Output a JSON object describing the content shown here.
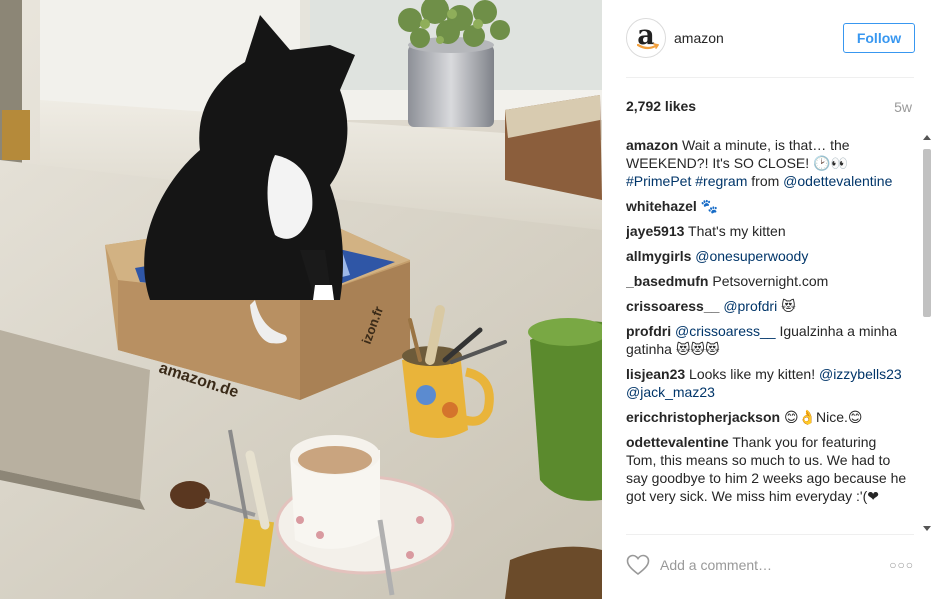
{
  "post": {
    "username": "amazon",
    "follow_label": "Follow",
    "likes": "2,792 likes",
    "age": "5w",
    "avatar_letter": "a",
    "add_comment_placeholder": "Add a comment…",
    "more_label": "○○○"
  },
  "photo_text": {
    "box_brand_1": "izon.fr",
    "box_brand_2": "amazon.de"
  },
  "comments": [
    {
      "user": "amazon",
      "parts": [
        {
          "t": "text",
          "v": " Wait a minute, is that… the WEEKEND?! It's SO CLOSE! 🕑👀 "
        },
        {
          "t": "link",
          "v": "#PrimePet"
        },
        {
          "t": "text",
          "v": " "
        },
        {
          "t": "link",
          "v": "#regram"
        },
        {
          "t": "text",
          "v": " from "
        },
        {
          "t": "link",
          "v": "@odettevalentine"
        }
      ]
    },
    {
      "user": "whitehazel",
      "parts": [
        {
          "t": "text",
          "v": " 🐾"
        }
      ]
    },
    {
      "user": "jaye5913",
      "parts": [
        {
          "t": "text",
          "v": " That's my kitten"
        }
      ]
    },
    {
      "user": "allmygirls",
      "parts": [
        {
          "t": "text",
          "v": " "
        },
        {
          "t": "link",
          "v": "@onesuperwoody"
        }
      ]
    },
    {
      "user": "_basedmufn",
      "parts": [
        {
          "t": "text",
          "v": " Petsovernight.com"
        }
      ]
    },
    {
      "user": "crissoaress__",
      "parts": [
        {
          "t": "text",
          "v": " "
        },
        {
          "t": "link",
          "v": "@profdri"
        },
        {
          "t": "text",
          "v": " 😻"
        }
      ]
    },
    {
      "user": "profdri",
      "parts": [
        {
          "t": "text",
          "v": " "
        },
        {
          "t": "link",
          "v": "@crissoaress__"
        },
        {
          "t": "text",
          "v": " Igualzinha a minha gatinha 😻😻😻"
        }
      ]
    },
    {
      "user": "lisjean23",
      "parts": [
        {
          "t": "text",
          "v": " Looks like my kitten! "
        },
        {
          "t": "link",
          "v": "@izzybells23"
        },
        {
          "t": "text",
          "v": " "
        },
        {
          "t": "link",
          "v": "@jack_maz23"
        }
      ]
    },
    {
      "user": "ericchristopherjackson",
      "parts": [
        {
          "t": "text",
          "v": " 😊👌Nice.😊"
        }
      ]
    },
    {
      "user": "odettevalentine",
      "parts": [
        {
          "t": "text",
          "v": " Thank you for featuring Tom, this means so much to us. We had to say goodbye to him 2 weeks ago because he got very sick. We miss him everyday :'(❤"
        }
      ]
    }
  ],
  "icons": {
    "heart": "heart-outline-icon",
    "more": "more-options-icon"
  },
  "colors": {
    "follow_blue": "#3897f0",
    "link_blue": "#003569",
    "muted_gray": "#999999"
  }
}
